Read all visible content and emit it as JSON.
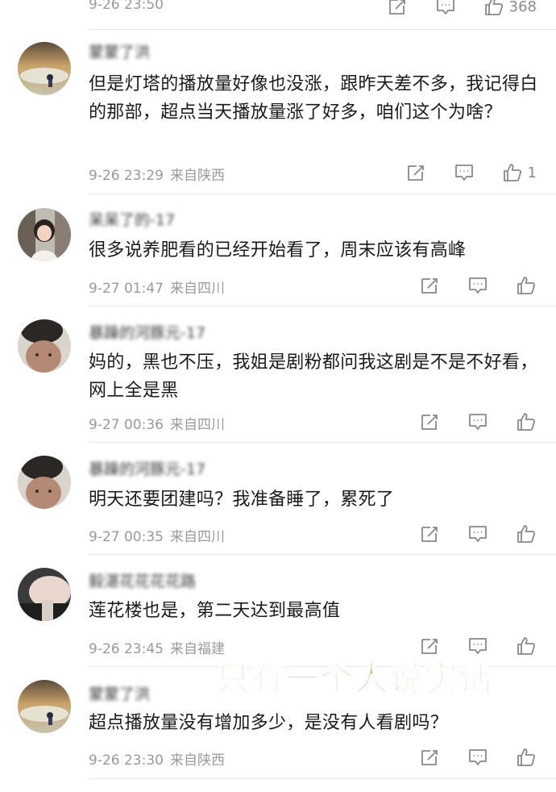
{
  "top": {
    "time": "9-26 23:50",
    "like_count": "368"
  },
  "comments": [
    {
      "username": "蒙蒙了洪",
      "text": "但是灯塔的播放量好像也没涨，跟昨天差不多，我记得白的那部，超点当天播放量涨了好多，咱们这个为啥？",
      "time": "9-26 23:29",
      "location": "来自陕西",
      "like_count": "1"
    },
    {
      "username": "呆呆了的-17",
      "text": "很多说养肥看的已经开始看了，周末应该有高峰",
      "time": "9-27 01:47",
      "location": "来自四川",
      "like_count": ""
    },
    {
      "username": "暴躁的河豚元-17",
      "text": "妈的，黑也不压，我姐是剧粉都问我这剧是不是不好看，网上全是黑",
      "time": "9-27 00:36",
      "location": "来自四川",
      "like_count": ""
    },
    {
      "username": "暴躁的河豚元-17",
      "text": "明天还要团建吗？我准备睡了，累死了",
      "time": "9-27 00:35",
      "location": "来自四川",
      "like_count": ""
    },
    {
      "username": "毅湛花花花花路",
      "text": "莲花楼也是，第二天达到最高值",
      "time": "9-26 23:45",
      "location": "来自福建",
      "like_count": ""
    },
    {
      "username": "蒙蒙了洪",
      "text": "超点播放量没有增加多少，是没有人看剧吗？",
      "time": "9-26 23:30",
      "location": "来自陕西",
      "like_count": ""
    }
  ],
  "overlay_caption": "只有一个人说实话",
  "icons": {
    "edit": "edit-icon",
    "comment": "comment-icon",
    "like": "like-icon"
  },
  "colors": {
    "overlay_text": "#9fe07c",
    "meta_text": "#9a9a9a"
  }
}
